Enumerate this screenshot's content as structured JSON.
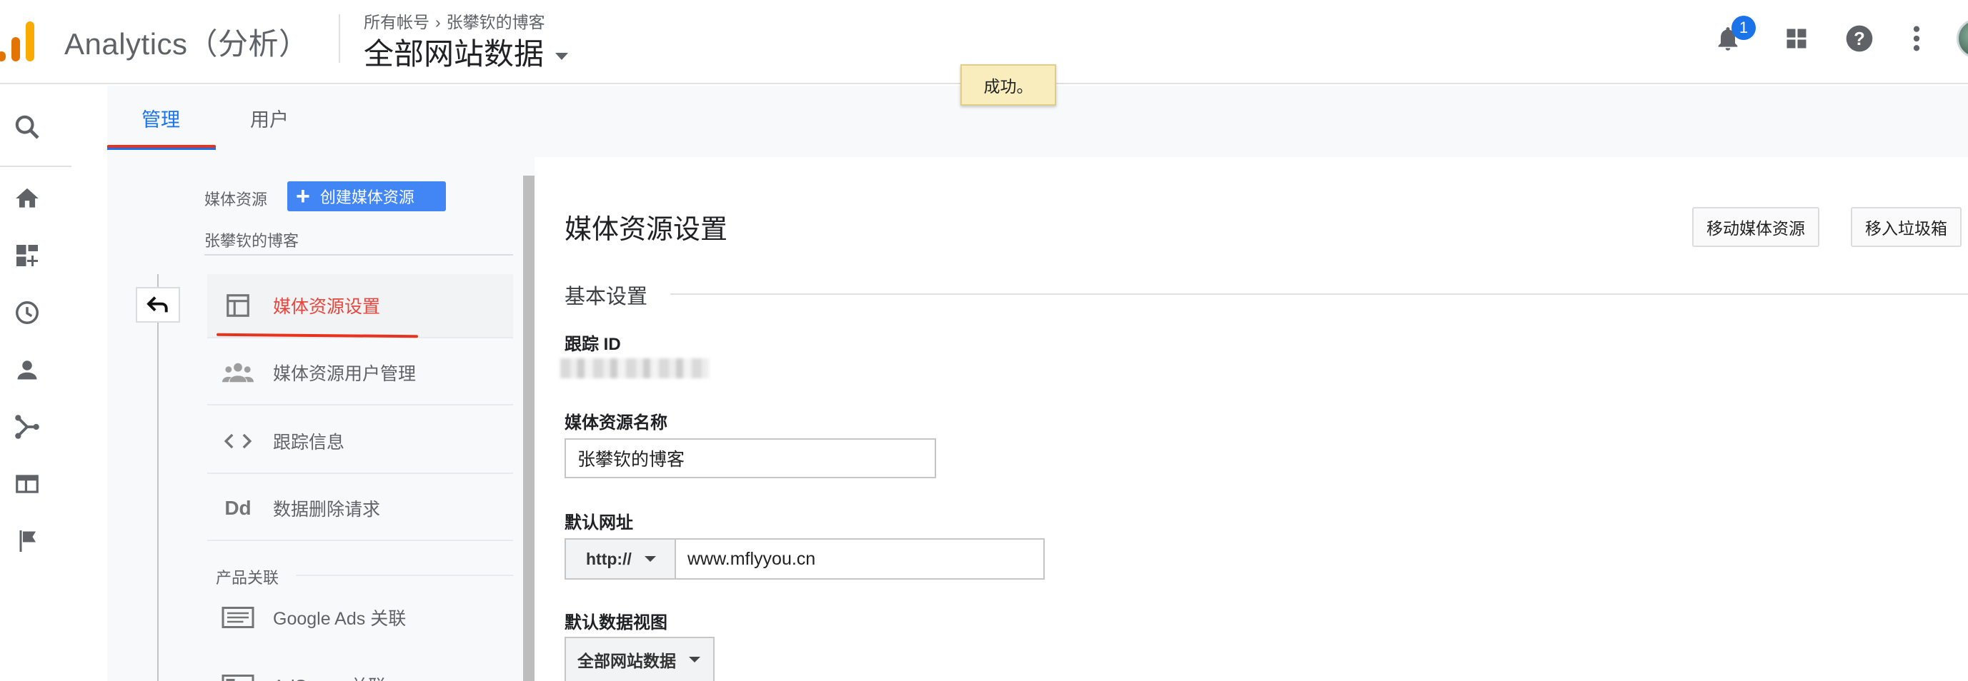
{
  "header": {
    "app_title": "Analytics（分析）",
    "breadcrumb": {
      "account": "所有帐号",
      "separator": "›",
      "property": "张攀钦的博客"
    },
    "view_name": "全部网站数据",
    "notification_count": "1"
  },
  "toast": {
    "message": "成功。"
  },
  "tabs": [
    {
      "label": "管理",
      "active": true
    },
    {
      "label": "用户",
      "active": false
    }
  ],
  "left_nav": {
    "section_label": "媒体资源",
    "create_button": "创建媒体资源",
    "property_name": "张攀钦的博客",
    "items": [
      {
        "label": "媒体资源设置",
        "icon": "layout-icon",
        "selected": true
      },
      {
        "label": "媒体资源用户管理",
        "icon": "people-icon",
        "selected": false
      },
      {
        "label": "跟踪信息",
        "icon": "code-icon",
        "selected": false
      },
      {
        "label": "数据删除请求",
        "icon": "dd-icon",
        "selected": false
      }
    ],
    "group_header": "产品关联",
    "group_items": [
      {
        "label": "Google Ads 关联",
        "icon": "ads-icon"
      },
      {
        "label": "AdSense 关联",
        "icon": "adsense-icon"
      }
    ]
  },
  "main": {
    "title": "媒体资源设置",
    "move_button": "移动媒体资源",
    "trash_button": "移入垃圾箱",
    "basic_settings": "基本设置",
    "tracking_id_label": "跟踪 ID",
    "property_name_label": "媒体资源名称",
    "property_name_value": "张攀钦的博客",
    "default_url_label": "默认网址",
    "protocol": "http://",
    "default_url_value": "www.mflyyou.cn",
    "default_view_label": "默认数据视图",
    "default_view_value": "全部网站数据"
  },
  "colors": {
    "accent": "#1a73e8",
    "create_button": "#4285f4",
    "selected_item": "#e8453c",
    "annotation_red": "#e8321e",
    "toast_bg": "#f9edbe"
  }
}
